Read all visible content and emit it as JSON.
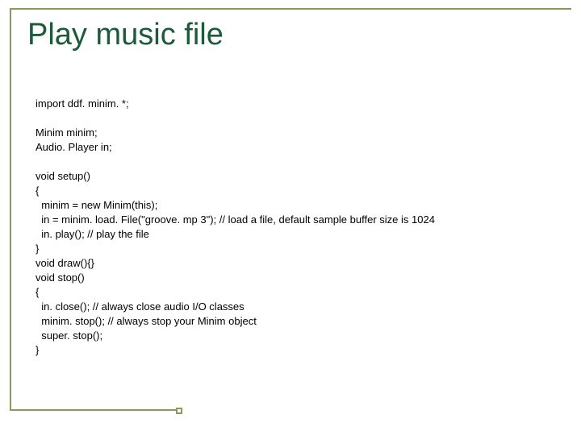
{
  "slide": {
    "title": "Play music file",
    "code_lines": [
      "import ddf. minim. *;",
      "",
      "Minim minim;",
      "Audio. Player in;",
      "",
      "void setup()",
      "{",
      "  minim = new Minim(this);",
      "  in = minim. load. File(\"groove. mp 3\"); // load a file, default sample buffer size is 1024",
      "  in. play(); // play the file",
      "}",
      "void draw(){}",
      "void stop()",
      "{",
      "  in. close(); // always close audio I/O classes",
      "  minim. stop(); // always stop your Minim object",
      "  super. stop();",
      "}"
    ]
  },
  "colors": {
    "accent": "#8a9a5b",
    "title": "#1b5b3a"
  }
}
